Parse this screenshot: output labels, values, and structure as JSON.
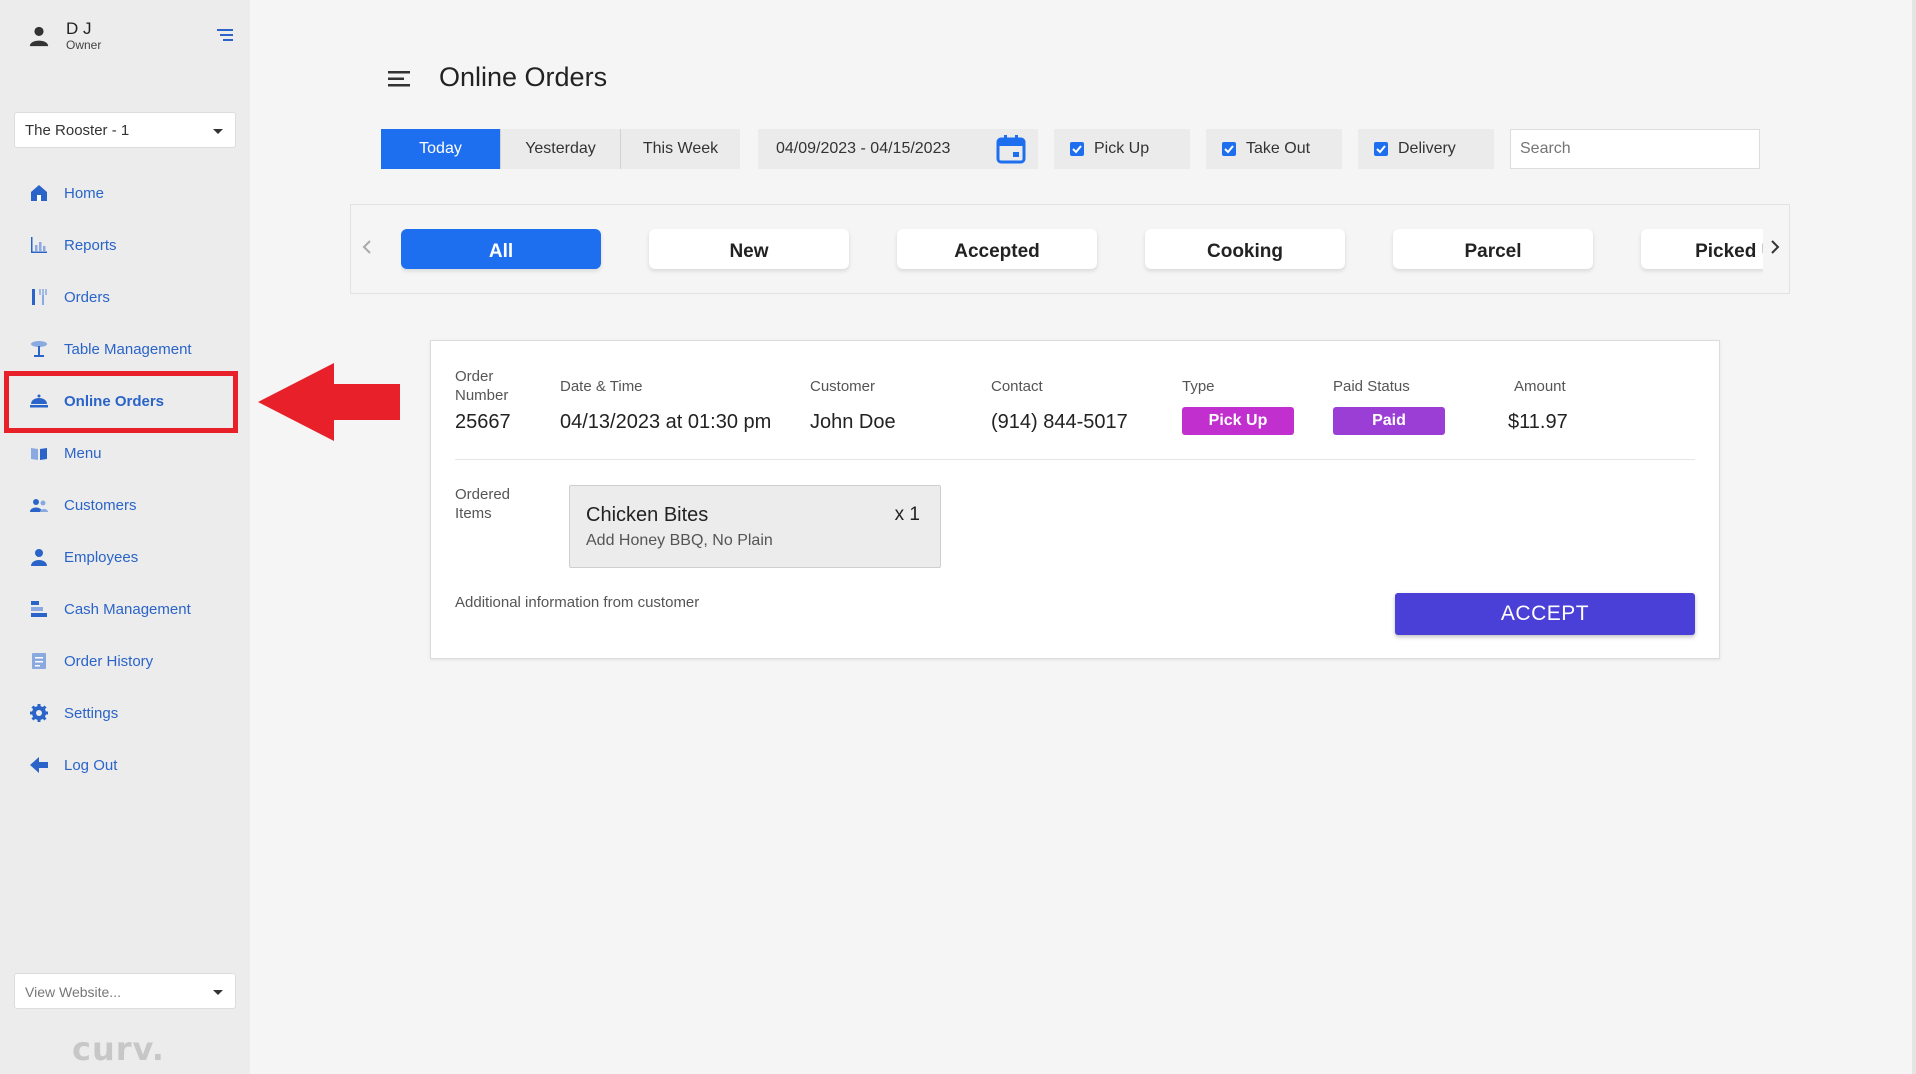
{
  "user": {
    "name": "D J",
    "role": "Owner"
  },
  "store_select": {
    "value": "The Rooster - 1"
  },
  "sidebar": {
    "items": [
      {
        "label": "Home",
        "icon": "home-icon"
      },
      {
        "label": "Reports",
        "icon": "reports-icon"
      },
      {
        "label": "Orders",
        "icon": "orders-icon"
      },
      {
        "label": "Table Management",
        "icon": "table-icon"
      },
      {
        "label": "Online Orders",
        "icon": "online-orders-icon",
        "active": true
      },
      {
        "label": "Menu",
        "icon": "menu-book-icon"
      },
      {
        "label": "Customers",
        "icon": "customers-icon"
      },
      {
        "label": "Employees",
        "icon": "employees-icon"
      },
      {
        "label": "Cash Management",
        "icon": "cash-icon"
      },
      {
        "label": "Order History",
        "icon": "order-history-icon"
      },
      {
        "label": "Settings",
        "icon": "gear-icon"
      },
      {
        "label": "Log Out",
        "icon": "logout-icon"
      }
    ]
  },
  "website_select": {
    "value": "View Website..."
  },
  "brand": {
    "text": "curv."
  },
  "page": {
    "title": "Online Orders"
  },
  "date_filters": {
    "today": "Today",
    "yesterday": "Yesterday",
    "this_week": "This Week"
  },
  "date_range": "04/09/2023 - 04/15/2023",
  "type_filters": {
    "pickup": "Pick Up",
    "takeout": "Take Out",
    "delivery": "Delivery"
  },
  "search": {
    "placeholder": "Search"
  },
  "status_tabs": [
    "All",
    "New",
    "Accepted",
    "Cooking",
    "Parcel",
    "Picked Up"
  ],
  "order": {
    "labels": {
      "order_number": "Order Number",
      "date_time": "Date & Time",
      "customer": "Customer",
      "contact": "Contact",
      "type": "Type",
      "paid_status": "Paid Status",
      "amount": "Amount",
      "ordered_items": "Ordered Items"
    },
    "number": "25667",
    "date_time": "04/13/2023 at 01:30 pm",
    "customer": "John Doe",
    "contact": "(914) 844-5017",
    "type": "Pick Up",
    "paid_status": "Paid",
    "amount": "$11.97",
    "items": [
      {
        "name": "Chicken Bites",
        "qty": "x 1",
        "modifiers": "Add Honey BBQ, No Plain"
      }
    ],
    "additional_info_label": "Additional information from customer",
    "accept_label": "ACCEPT"
  },
  "colors": {
    "primary": "#1e6ff0",
    "nav_text": "#2a64c9",
    "type_badge": "#c22fcf",
    "paid_badge": "#9a3ed6",
    "accept_button": "#4a3fd6",
    "highlight": "#e8202a"
  }
}
